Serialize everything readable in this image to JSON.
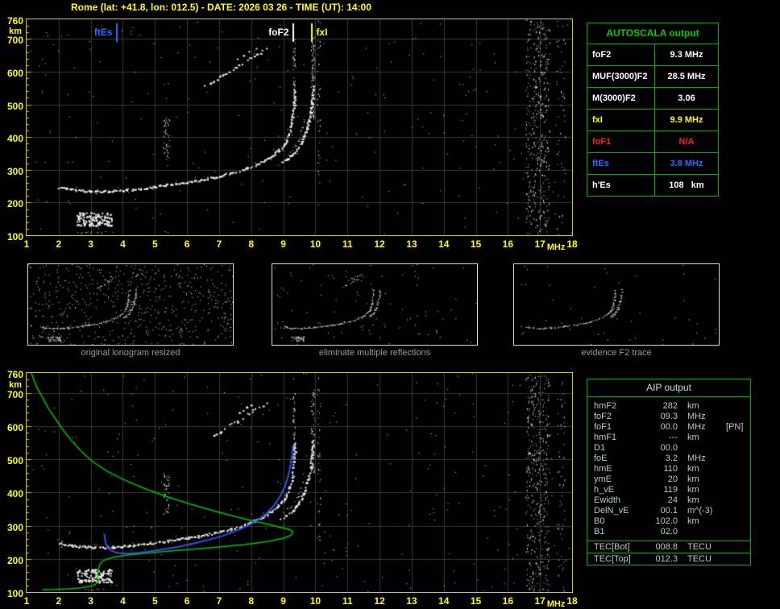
{
  "header": {
    "title": "Rome (lat: +41.8, lon: 012.5) - DATE: 2026 03 26 - TIME (UT): 14:00"
  },
  "ionogram": {
    "markers": [
      {
        "label": "ftEs",
        "freq": 3.8,
        "color": "#2e6cff",
        "side": "left"
      },
      {
        "label": "foF2",
        "freq": 9.3,
        "color": "#ffffff",
        "side": "left"
      },
      {
        "label": "fxI",
        "freq": 9.9,
        "color": "#ffff00",
        "side": "right"
      }
    ]
  },
  "thumbnails": {
    "captions": [
      "original ionogram resized",
      "eliminate multiple reflections",
      "evidence F2 trace"
    ]
  },
  "autoscala_table": {
    "title": "AUTOSCALA output",
    "rows": [
      {
        "label": "foF2",
        "value": "9.3 MHz",
        "color": "#ffffff"
      },
      {
        "label": "MUF(3000)F2",
        "value": "28.5 MHz",
        "color": "#ffffff"
      },
      {
        "label": "M(3000)F2",
        "value": "3.06",
        "color": "#ffffff"
      },
      {
        "label": "fxI",
        "value": "9.9 MHz",
        "color": "#ffff00"
      },
      {
        "label": "foF1",
        "value": "N/A",
        "color": "#ff2222"
      },
      {
        "label": "ftEs",
        "value": "3.8 MHz",
        "color": "#2e6cff"
      },
      {
        "label": "h'Es",
        "value": "108   km",
        "color": "#ffffff"
      }
    ]
  },
  "aip_table": {
    "title": "AIP output",
    "rows": [
      {
        "label": "hmF2",
        "value": "282",
        "unit": "km"
      },
      {
        "label": "foF2",
        "value": "09.3",
        "unit": "MHz"
      },
      {
        "label": "foF1",
        "value": "00.0",
        "unit": "MHz",
        "note": "[PN]"
      },
      {
        "label": "hmF1",
        "value": "---",
        "unit": "km"
      },
      {
        "label": "D1",
        "value": "00.0",
        "unit": ""
      },
      {
        "label": "foE",
        "value": "3.2",
        "unit": "MHz"
      },
      {
        "label": "hmE",
        "value": "110",
        "unit": "km"
      },
      {
        "label": "ymE",
        "value": "20",
        "unit": "km"
      },
      {
        "label": "h_vE",
        "value": "119",
        "unit": "km"
      },
      {
        "label": "Ewidth",
        "value": "24",
        "unit": "km"
      },
      {
        "label": "DelN_vE",
        "value": "00.1",
        "unit": "m^(-3)"
      },
      {
        "label": "B0",
        "value": "102.0",
        "unit": "km"
      },
      {
        "label": "B1",
        "value": "02.0",
        "unit": ""
      }
    ],
    "tec_rows": [
      {
        "label": "TEC[Bot]",
        "value": "008.8",
        "unit": "TECU"
      },
      {
        "label": "TEC[Top]",
        "value": "012.3",
        "unit": "TECU"
      }
    ]
  },
  "chart_data": {
    "type": "scatter",
    "xlabel": "MHz",
    "ylabel": "km",
    "xlim": [
      1,
      18
    ],
    "ylim": [
      100,
      760
    ],
    "x_ticks": [
      "1",
      "2",
      "3",
      "4",
      "5",
      "6",
      "7",
      "8",
      "9",
      "10",
      "11",
      "12",
      "13",
      "14",
      "15",
      "16",
      "17",
      "18"
    ],
    "y_ticks": [
      "760",
      "700",
      "600",
      "500",
      "400",
      "300",
      "200",
      "100"
    ],
    "grid": true,
    "colors": {
      "grid": "#3a3a30",
      "axis": "#cfcf00",
      "dots": "#e9e9e9",
      "profile": "#00c400",
      "fit": "#2d53e8"
    },
    "traces": {
      "f2_o": [
        [
          2.0,
          248
        ],
        [
          2.2,
          244
        ],
        [
          2.5,
          240
        ],
        [
          2.8,
          237
        ],
        [
          3.1,
          236
        ],
        [
          3.4,
          236
        ],
        [
          3.7,
          237
        ],
        [
          4.0,
          239
        ],
        [
          4.3,
          242
        ],
        [
          4.7,
          246
        ],
        [
          5.1,
          251
        ],
        [
          5.5,
          257
        ],
        [
          6.0,
          264
        ],
        [
          6.5,
          272
        ],
        [
          7.0,
          282
        ],
        [
          7.4,
          292
        ],
        [
          7.8,
          304
        ],
        [
          8.1,
          316
        ],
        [
          8.4,
          330
        ],
        [
          8.6,
          342
        ],
        [
          8.8,
          358
        ],
        [
          9.0,
          378
        ],
        [
          9.1,
          396
        ],
        [
          9.18,
          416
        ],
        [
          9.24,
          440
        ],
        [
          9.28,
          465
        ],
        [
          9.31,
          492
        ],
        [
          9.33,
          520
        ],
        [
          9.34,
          548
        ]
      ],
      "f2_x": [
        [
          8.9,
          322
        ],
        [
          9.1,
          334
        ],
        [
          9.3,
          350
        ],
        [
          9.45,
          368
        ],
        [
          9.55,
          386
        ],
        [
          9.65,
          406
        ],
        [
          9.72,
          428
        ],
        [
          9.78,
          452
        ],
        [
          9.83,
          478
        ],
        [
          9.87,
          506
        ],
        [
          9.9,
          534
        ],
        [
          9.91,
          556
        ]
      ],
      "f2_x2": [
        [
          9.0,
          340
        ],
        [
          9.2,
          355
        ],
        [
          9.35,
          372
        ],
        [
          9.45,
          390
        ],
        [
          9.52,
          410
        ],
        [
          9.58,
          432
        ],
        [
          9.62,
          455
        ]
      ],
      "hop2_a": [
        [
          6.55,
          558
        ],
        [
          6.8,
          572
        ],
        [
          7.1,
          590
        ],
        [
          7.4,
          608
        ],
        [
          7.7,
          626
        ],
        [
          8.0,
          644
        ],
        [
          8.25,
          660
        ],
        [
          8.45,
          672
        ]
      ],
      "hop2_b": [
        [
          7.35,
          630
        ],
        [
          7.6,
          644
        ],
        [
          7.85,
          658
        ],
        [
          8.05,
          668
        ],
        [
          8.2,
          676
        ]
      ],
      "es_box": {
        "f": [
          2.55,
          3.65
        ],
        "h": [
          130,
          170
        ]
      },
      "es_line": [
        [
          2.6,
          110
        ],
        [
          3.0,
          109
        ],
        [
          3.4,
          108
        ]
      ],
      "noise_stripes": [
        {
          "f": [
            16.55,
            17.3
          ],
          "h": [
            100,
            760
          ],
          "density": 0.15
        },
        {
          "f": [
            17.5,
            17.78
          ],
          "h": [
            100,
            760
          ],
          "density": 0.05
        },
        {
          "f": [
            9.29,
            9.37
          ],
          "h": [
            490,
            700
          ],
          "density": 0.5
        },
        {
          "f": [
            9.85,
            9.97
          ],
          "h": [
            460,
            710
          ],
          "density": 0.5
        },
        {
          "f": [
            5.25,
            5.45
          ],
          "h": [
            330,
            460
          ],
          "density": 0.3
        },
        {
          "f": [
            10.05,
            10.15
          ],
          "h": [
            250,
            760
          ],
          "density": 0.12
        }
      ]
    },
    "profile_green": [
      [
        1.15,
        760
      ],
      [
        1.3,
        720
      ],
      [
        1.5,
        685
      ],
      [
        1.7,
        650
      ],
      [
        1.95,
        615
      ],
      [
        2.2,
        580
      ],
      [
        2.5,
        545
      ],
      [
        2.8,
        515
      ],
      [
        3.1,
        490
      ],
      [
        3.5,
        465
      ],
      [
        4.0,
        440
      ],
      [
        4.6,
        415
      ],
      [
        5.3,
        390
      ],
      [
        6.1,
        365
      ],
      [
        7.0,
        340
      ],
      [
        7.9,
        318
      ],
      [
        8.7,
        300
      ],
      [
        9.2,
        288
      ],
      [
        9.3,
        282
      ],
      [
        9.25,
        272
      ],
      [
        9.0,
        262
      ],
      [
        8.5,
        252
      ],
      [
        7.8,
        243
      ],
      [
        7.0,
        236
      ],
      [
        6.2,
        229
      ],
      [
        5.4,
        223
      ],
      [
        4.7,
        217
      ],
      [
        4.1,
        211
      ],
      [
        3.7,
        205
      ],
      [
        3.45,
        198
      ],
      [
        3.33,
        190
      ],
      [
        3.28,
        182
      ],
      [
        3.25,
        172
      ],
      [
        3.23,
        162
      ],
      [
        3.22,
        152
      ],
      [
        3.21,
        142
      ],
      [
        3.2,
        132
      ],
      [
        3.15,
        124
      ],
      [
        3.0,
        118
      ],
      [
        2.7,
        113
      ],
      [
        2.3,
        110
      ],
      [
        1.9,
        108
      ],
      [
        1.5,
        107
      ]
    ],
    "fit_blue": [
      [
        3.42,
        276
      ],
      [
        3.44,
        260
      ],
      [
        3.47,
        246
      ],
      [
        3.52,
        235
      ],
      [
        3.6,
        227
      ],
      [
        3.72,
        221
      ],
      [
        3.9,
        217
      ],
      [
        4.15,
        216
      ],
      [
        4.45,
        218
      ],
      [
        4.8,
        222
      ],
      [
        5.2,
        228
      ],
      [
        5.7,
        236
      ],
      [
        6.2,
        246
      ],
      [
        6.7,
        258
      ],
      [
        7.2,
        272
      ],
      [
        7.6,
        287
      ],
      [
        7.95,
        303
      ],
      [
        8.25,
        320
      ],
      [
        8.5,
        339
      ],
      [
        8.72,
        362
      ],
      [
        8.9,
        388
      ],
      [
        9.05,
        418
      ],
      [
        9.15,
        448
      ],
      [
        9.22,
        480
      ],
      [
        9.27,
        512
      ],
      [
        9.3,
        542
      ]
    ]
  }
}
